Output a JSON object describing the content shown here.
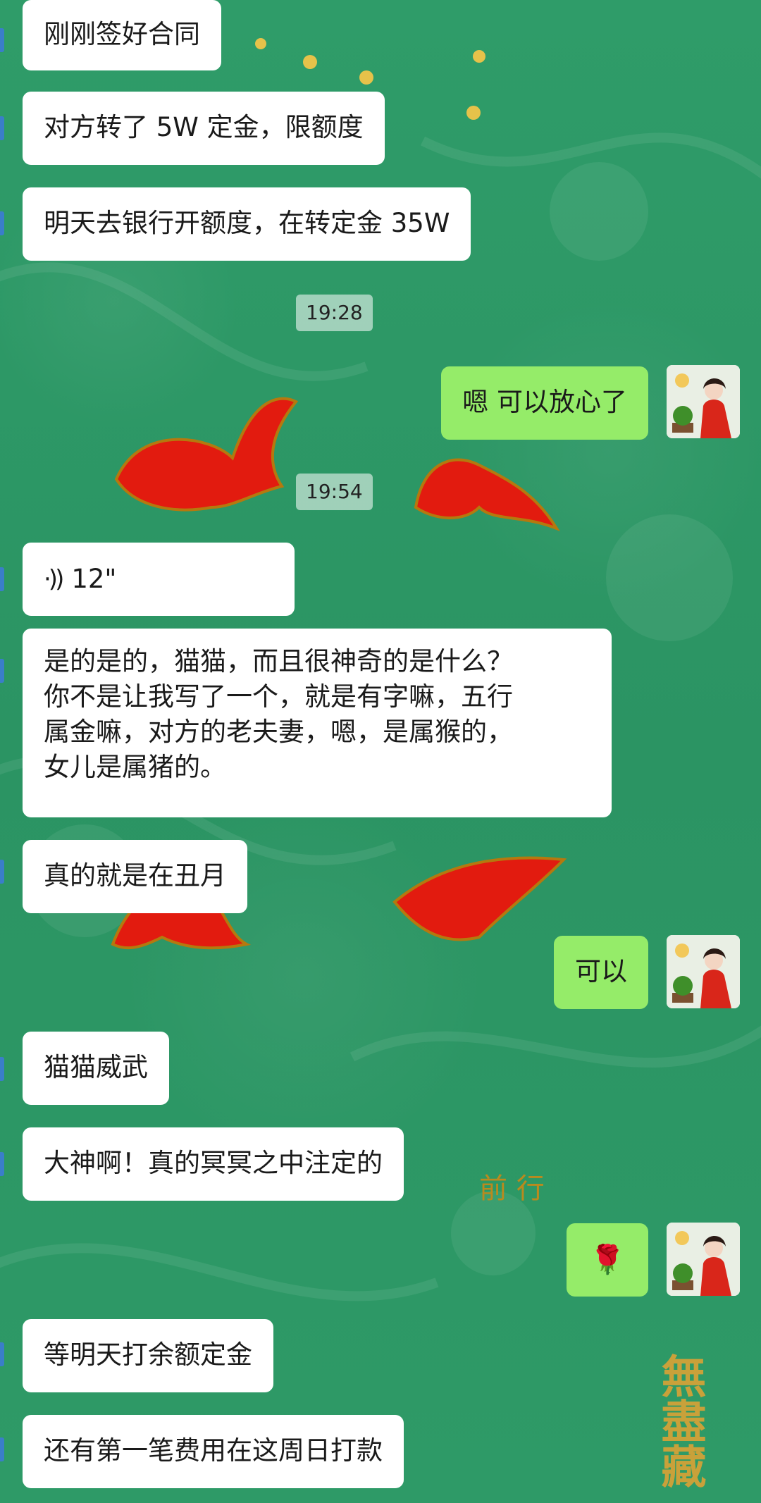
{
  "theme": {
    "accent_self": "#95ec69",
    "bubble_other": "#ffffff",
    "wallpaper": "#2f9a68",
    "ornament_red": "#e21b0f"
  },
  "messages": [
    {
      "text": "刚刚签好合同",
      "from": "other"
    },
    {
      "text": "对方转了 5W 定金，限额度",
      "from": "other"
    },
    {
      "text": "明天去银行开额度，在转定金 35W",
      "from": "other"
    },
    {
      "time": "19:28"
    },
    {
      "text": "嗯 可以放心了",
      "from": "self"
    },
    {
      "time": "19:54"
    },
    {
      "voice": "12\"",
      "icon": "voice-wave-icon",
      "from": "other"
    },
    {
      "lines": [
        "是的是的，猫猫，而且很神奇的是什么？",
        "你不是让我写了一个，就是有字嘛，五行",
        "属金嘛，对方的老夫妻，嗯，是属猴的，",
        "女儿是属猪的。"
      ],
      "from": "other"
    },
    {
      "text": "真的就是在丑月",
      "from": "other"
    },
    {
      "text": "可以",
      "from": "self"
    },
    {
      "text": "猫猫威武",
      "from": "other"
    },
    {
      "text": "大神啊！真的冥冥之中注定的",
      "from": "other"
    },
    {
      "emoji": "🌹",
      "icon": "rose-emoji",
      "from": "self"
    },
    {
      "text": "等明天打余额定金",
      "from": "other"
    },
    {
      "text": "还有第一笔费用在这周日打款",
      "from": "other"
    }
  ],
  "wallpaper_text": {
    "mid": "前 行",
    "right": "無盡藏"
  }
}
